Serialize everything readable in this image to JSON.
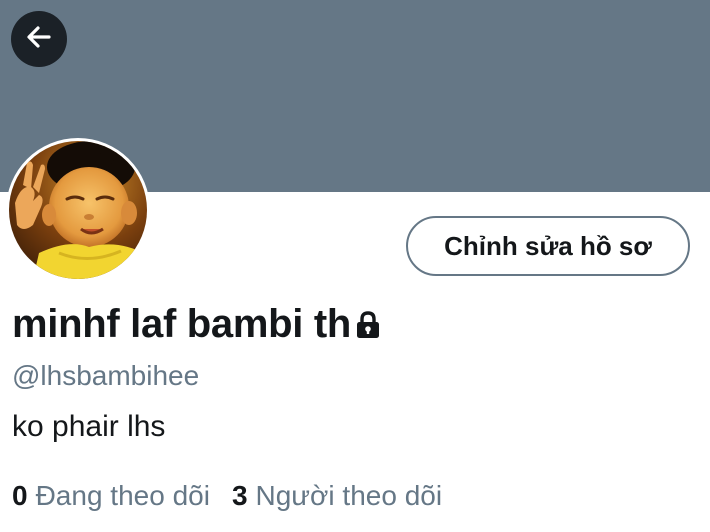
{
  "header": {
    "banner_color": "#657786",
    "back_icon": "arrow-left-icon"
  },
  "profile": {
    "avatar_icon": "profile-photo",
    "edit_button_label": "Chỉnh sửa hồ sơ",
    "display_name": "minhf laf bambi th",
    "protected_icon": "lock-icon",
    "handle": "@lhsbambihee",
    "bio": "ko phair lhs"
  },
  "stats": {
    "following_count": "0",
    "following_label": "Đang theo dõi",
    "followers_count": "3",
    "followers_label": "Người theo dõi"
  }
}
